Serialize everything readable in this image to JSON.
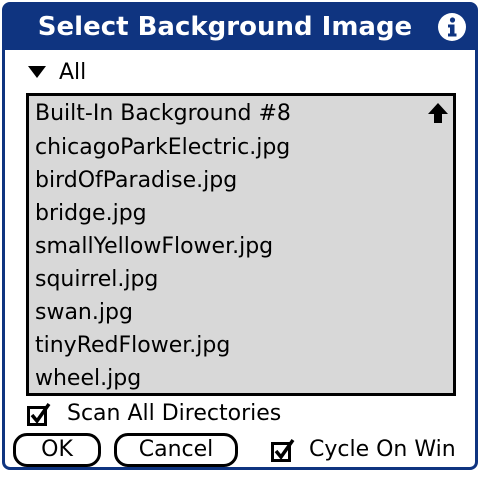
{
  "dialog": {
    "title": "Select Background Image",
    "accent_color": "#0f3480",
    "info_icon": "info-icon"
  },
  "filter": {
    "selected": "All",
    "icon": "triangle-down-icon"
  },
  "list": {
    "items": [
      "Built-In Background #8",
      "chicagoParkElectric.jpg",
      "birdOfParadise.jpg",
      "bridge.jpg",
      "smallYellowFlower.jpg",
      "squirrel.jpg",
      "swan.jpg",
      "tinyRedFlower.jpg",
      "wheel.jpg"
    ],
    "scroll_icon": "arrow-up-icon",
    "background_color": "#d8d8d8"
  },
  "options": {
    "scan_all_label": "Scan All Directories",
    "scan_all_checked": true,
    "cycle_label": "Cycle On Win",
    "cycle_checked": true
  },
  "buttons": {
    "ok_label": "OK",
    "cancel_label": "Cancel"
  }
}
